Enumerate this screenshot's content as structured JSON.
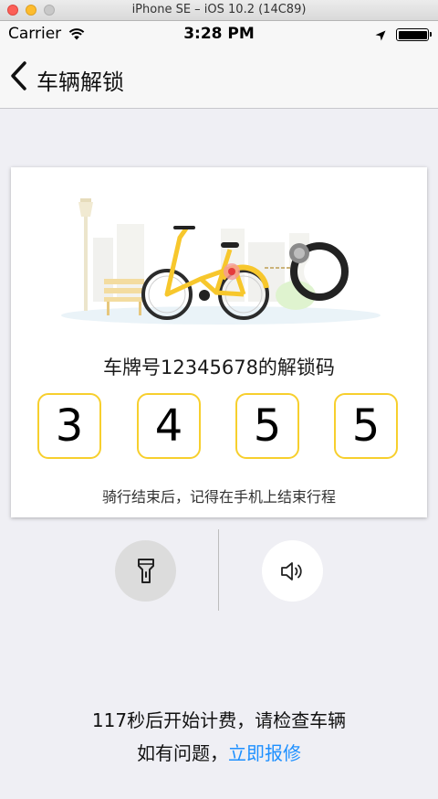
{
  "window": {
    "title": "iPhone SE – iOS 10.2 (14C89)"
  },
  "status_bar": {
    "carrier": "Carrier",
    "time": "3:28 PM",
    "wifi_icon": "wifi-icon",
    "location_icon": "location-arrow-icon",
    "battery_icon": "battery-full-icon"
  },
  "nav": {
    "back_icon": "chevron-left-icon",
    "title": "车辆解锁"
  },
  "card": {
    "illustration": "bike-unlock-illustration",
    "plate_text": "车牌号12345678的解锁码",
    "code_digits": [
      "3",
      "4",
      "5",
      "5"
    ],
    "reminder": "骑行结束后，记得在手机上结束行程",
    "accent_color": "#f7cf2d"
  },
  "controls": {
    "flashlight_icon": "flashlight-icon",
    "sound_icon": "speaker-icon"
  },
  "footer": {
    "notice": "117秒后开始计费，请检查车辆",
    "help_prefix": "如有问题，",
    "repair_link": "立即报修",
    "link_color": "#1e90ff"
  }
}
